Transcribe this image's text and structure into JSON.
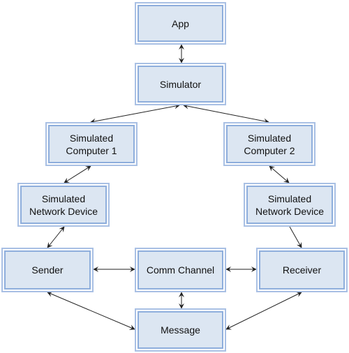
{
  "nodes": {
    "app": "App",
    "simulator": "Simulator",
    "computer1": "Simulated\nComputer 1",
    "computer2": "Simulated\nComputer 2",
    "netdev1": "Simulated\nNetwork Device",
    "netdev2": "Simulated\nNetwork Device",
    "sender": "Sender",
    "comm": "Comm Channel",
    "receiver": "Receiver",
    "message": "Message"
  },
  "edges": [
    {
      "from": "app",
      "to": "simulator",
      "direction": "both"
    },
    {
      "from": "simulator",
      "to": "computer1",
      "direction": "both"
    },
    {
      "from": "simulator",
      "to": "computer2",
      "direction": "both"
    },
    {
      "from": "computer1",
      "to": "netdev1",
      "direction": "both"
    },
    {
      "from": "computer2",
      "to": "netdev2",
      "direction": "both"
    },
    {
      "from": "netdev1",
      "to": "sender",
      "direction": "both"
    },
    {
      "from": "netdev2",
      "to": "receiver",
      "direction": "forward"
    },
    {
      "from": "sender",
      "to": "comm",
      "direction": "both"
    },
    {
      "from": "comm",
      "to": "receiver",
      "direction": "both"
    },
    {
      "from": "comm",
      "to": "message",
      "direction": "both"
    },
    {
      "from": "sender",
      "to": "message",
      "direction": "both"
    },
    {
      "from": "receiver",
      "to": "message",
      "direction": "both"
    }
  ],
  "colors": {
    "fill": "#dce6f2",
    "border": "#8eaedc",
    "arrow": "#222222"
  }
}
